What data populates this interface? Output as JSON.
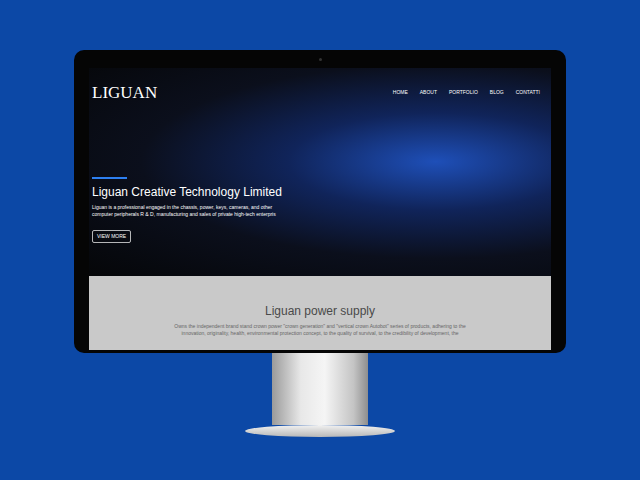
{
  "site": {
    "logo": "LIGUAN",
    "nav": [
      {
        "label": "HOME"
      },
      {
        "label": "ABOUT"
      },
      {
        "label": "PORTFOLIO"
      },
      {
        "label": "BLOG"
      },
      {
        "label": "CONTATTI"
      }
    ],
    "hero": {
      "title": "Liguan Creative Technology Limited",
      "description": [
        "Liguan is a professional engaged in the chassis, power, keys, cameras, and other",
        "computer peripherals R & D, manufacturing and sales of private high-tech enterpris"
      ],
      "button": "VIEW MORE"
    },
    "section": {
      "heading": "Liguan power supply",
      "text": [
        "Owns the independent brand stand crown power \"crown generation\" and \"vertical crown Autobot\" series of products, adhering to the",
        "innovation, originality, health, environmental protection concept, to the quality of survival, to the credibility of development, the"
      ]
    }
  }
}
